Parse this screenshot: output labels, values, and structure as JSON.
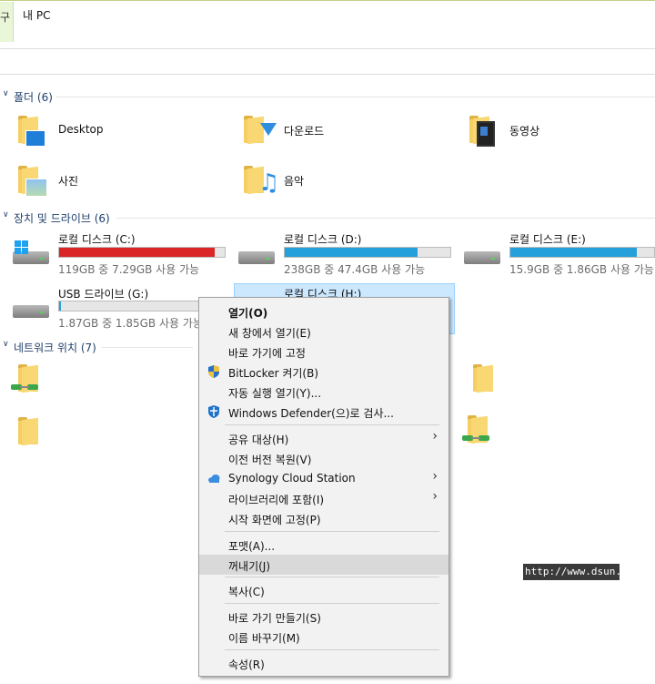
{
  "tab_stub": "구",
  "window_title": "내 PC",
  "groups": [
    {
      "label": "폴더 (6)"
    },
    {
      "label": "장치 및 드라이브 (6)"
    },
    {
      "label": "네트워크 위치 (7)"
    }
  ],
  "folders": [
    {
      "name": "Desktop"
    },
    {
      "name": "다운로드"
    },
    {
      "name": "동영상"
    },
    {
      "name": "사진"
    },
    {
      "name": "음악"
    }
  ],
  "drives": [
    {
      "name": "로컬 디스크 (C:)",
      "space": "119GB 중 7.29GB 사용 가능",
      "used_fraction": 0.94,
      "fill_color": "#da2626"
    },
    {
      "name": "로컬 디스크 (D:)",
      "space": "238GB 중 47.4GB 사용 가능",
      "used_fraction": 0.8,
      "fill_color": "#26a0da"
    },
    {
      "name": "로컬 디스크 (E:)",
      "space": "15.9GB 중 1.86GB 사용 가능",
      "used_fraction": 0.88,
      "fill_color": "#26a0da"
    },
    {
      "name": "USB 드라이브 (G:)",
      "space": "1.87GB 중 1.85GB 사용 가능",
      "used_fraction": 0.01,
      "fill_color": "#26a0da"
    },
    {
      "name": "로컬 디스크 (H:)"
    }
  ],
  "context_menu": {
    "items": [
      {
        "label": "열기(O)"
      },
      {
        "label": "새 창에서 열기(E)"
      },
      {
        "label": "바로 가기에 고정"
      },
      {
        "label": "BitLocker 켜기(B)",
        "icon": "shield-icon"
      },
      {
        "label": "자동 실행 열기(Y)..."
      },
      {
        "label": "Windows Defender(으)로 검사...",
        "icon": "defender-icon"
      },
      {
        "label": "공유 대상(H)"
      },
      {
        "label": "이전 버전 복원(V)"
      },
      {
        "label": "Synology Cloud Station",
        "icon": "cloud-icon"
      },
      {
        "label": "라이브러리에 포함(I)"
      },
      {
        "label": "시작 화면에 고정(P)"
      },
      {
        "label": "포맷(A)..."
      },
      {
        "label": "꺼내기(J)"
      },
      {
        "label": "복사(C)"
      },
      {
        "label": "바로 가기 만들기(S)"
      },
      {
        "label": "이름 바꾸기(M)"
      },
      {
        "label": "속성(R)"
      }
    ],
    "highlighted": "꺼내기(J)"
  },
  "watermark": "http://www.dsun.k"
}
